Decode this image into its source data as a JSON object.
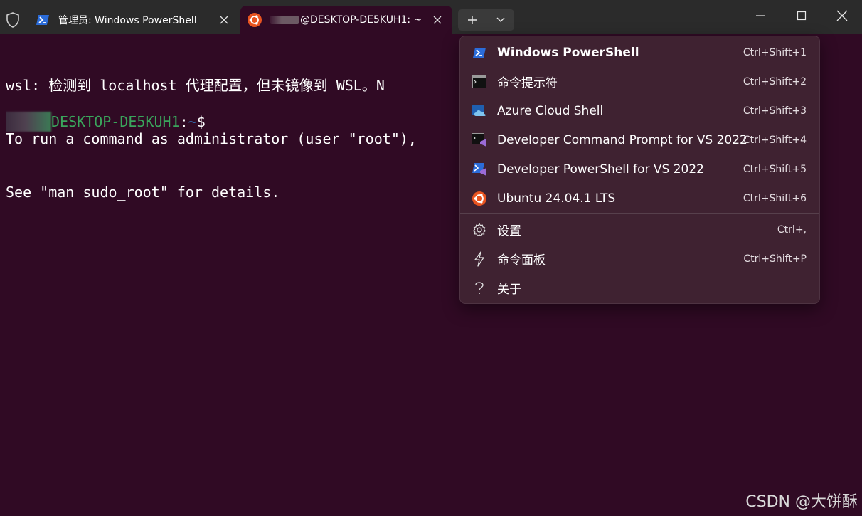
{
  "titlebar": {
    "tabs": [
      {
        "label": "管理员: Windows PowerShell",
        "icon": "powershell-icon"
      },
      {
        "label": "@DESKTOP-DE5KUH1: ~",
        "icon": "ubuntu-icon"
      }
    ]
  },
  "terminal": {
    "lines": [
      "wsl: 检测到 localhost 代理配置，但未镜像到 WSL。N",
      "To run a command as administrator (user \"root\"),",
      "See \"man sudo_root\" for details."
    ],
    "prompt": {
      "host": "DESKTOP-DE5KUH1",
      "colon": ":",
      "path": "~",
      "symbol": "$"
    }
  },
  "menu": {
    "items": [
      {
        "label": "Windows PowerShell",
        "shortcut": "Ctrl+Shift+1",
        "icon": "powershell-icon"
      },
      {
        "label": "命令提示符",
        "shortcut": "Ctrl+Shift+2",
        "icon": "cmd-icon"
      },
      {
        "label": "Azure Cloud Shell",
        "shortcut": "Ctrl+Shift+3",
        "icon": "azure-cloud-icon"
      },
      {
        "label": "Developer Command Prompt for VS 2022",
        "shortcut": "Ctrl+Shift+4",
        "icon": "vs-cmd-icon"
      },
      {
        "label": "Developer PowerShell for VS 2022",
        "shortcut": "Ctrl+Shift+5",
        "icon": "vs-powershell-icon"
      },
      {
        "label": "Ubuntu 24.04.1 LTS",
        "shortcut": "Ctrl+Shift+6",
        "icon": "ubuntu-icon"
      },
      {
        "label": "设置",
        "shortcut": "Ctrl+,",
        "icon": "gear-icon"
      },
      {
        "label": "命令面板",
        "shortcut": "Ctrl+Shift+P",
        "icon": "lightning-icon"
      },
      {
        "label": "关于",
        "shortcut": "",
        "icon": "question-icon"
      }
    ]
  },
  "watermark": "CSDN @大饼酥",
  "colors": {
    "background": "#300a24",
    "menu": "#3f2231",
    "titlebar": "#2b2b2b",
    "host": "#3aa55c",
    "path": "#3465a4"
  }
}
